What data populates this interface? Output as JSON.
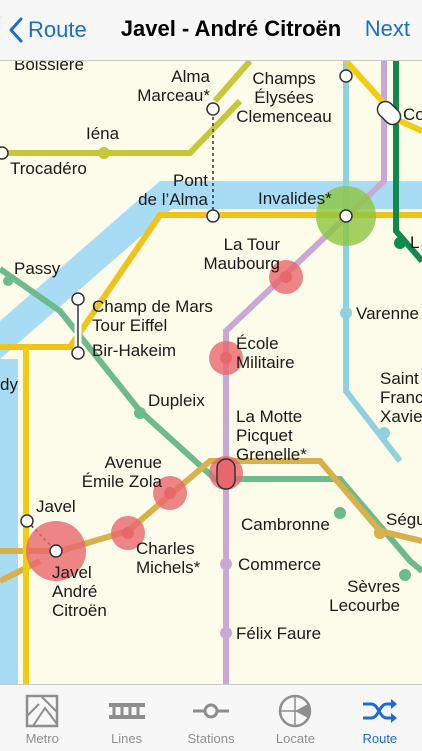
{
  "navbar": {
    "back_label": "Route",
    "title": "Javel - André Citroën",
    "next_label": "Next"
  },
  "stations": {
    "boissiere": "Boissière",
    "alma_marceau": [
      "Alma",
      "Marceau*"
    ],
    "champs_elysees": [
      "Champs",
      "Élysées",
      "Clemenceau"
    ],
    "iena": "Iéna",
    "trocadero": "Trocadéro",
    "pont_alma": [
      "Pont",
      "de l’Alma"
    ],
    "invalides": "Invalides*",
    "latour_maubourg": [
      "La Tour",
      "Maubourg"
    ],
    "passy": "Passy",
    "champ_de_mars": [
      "Champ de Mars",
      "Tour Eiffel"
    ],
    "bir_hakeim": "Bir-Hakeim",
    "varenne": "Varenne",
    "ecole_militaire": [
      "École",
      "Militaire"
    ],
    "dy": "dy",
    "dupleix": "Dupleix",
    "saint_francois": [
      "Saint",
      "Franc",
      "Xavie"
    ],
    "la_motte": [
      "La Motte",
      "Picquet",
      "Grenelle*"
    ],
    "avenue_zola": [
      "Avenue",
      "Émile Zola"
    ],
    "javel": "Javel",
    "cambronne": "Cambronne",
    "segur": "Ségu",
    "javel_citroen": [
      "Javel",
      "André",
      "Citroën"
    ],
    "charles_michels": [
      "Charles",
      "Michels*"
    ],
    "commerce": "Commerce",
    "sevres": [
      "Sèvres",
      "Lecourbe"
    ],
    "felix_faure": "Félix Faure",
    "co": "Co",
    "l_edge": "L"
  },
  "tabs": [
    {
      "label": "Metro",
      "icon": "metro-map-icon"
    },
    {
      "label": "Lines",
      "icon": "lines-icon"
    },
    {
      "label": "Stations",
      "icon": "stations-icon"
    },
    {
      "label": "Locate",
      "icon": "locate-icon"
    },
    {
      "label": "Route",
      "icon": "route-shuffle-icon"
    }
  ],
  "colors": {
    "accent": "#1a6cd8",
    "river": "#a8dcf5",
    "line6": "#6dbb8c",
    "line8": "#c9a8d6",
    "line10": "#d9b04a",
    "line9": "#c7c73a",
    "line13": "#8fd1dc",
    "rer_c": "#f0c21c",
    "line1": "#f2cc14",
    "line12": "#0f8a4f",
    "route_marker": "#e8676b",
    "transfer_marker": "#8cc63f"
  }
}
